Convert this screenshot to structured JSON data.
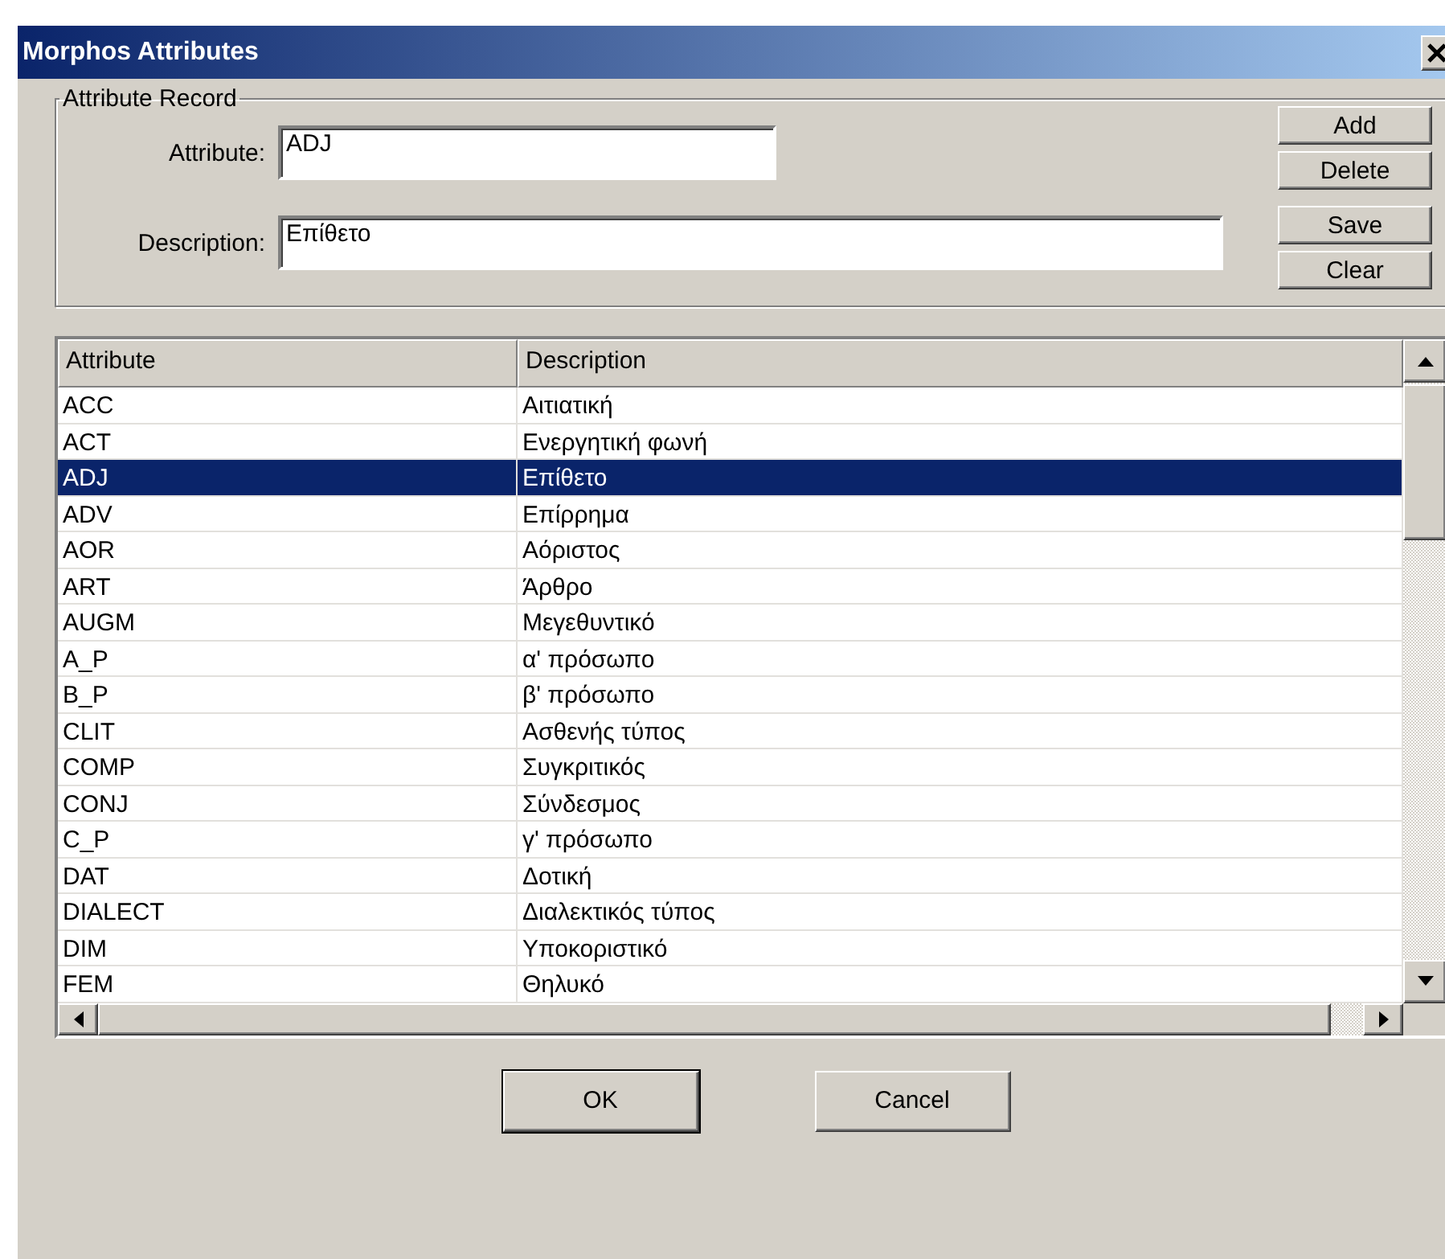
{
  "window": {
    "title": "Morphos Attributes"
  },
  "record": {
    "legend": "Attribute Record",
    "fields": [
      {
        "label": "Attribute:",
        "value": "ADJ",
        "kind": "short"
      },
      {
        "label": "Description:",
        "value": "Επίθετο",
        "kind": "long"
      }
    ],
    "buttons": [
      "Add",
      "Delete",
      "Save",
      "Clear"
    ]
  },
  "table": {
    "columns": [
      "Attribute",
      "Description"
    ],
    "rows": [
      {
        "cells": [
          "ACC",
          "Αιτιατική"
        ],
        "selected": false
      },
      {
        "cells": [
          "ACT",
          "Ενεργητική φωνή"
        ],
        "selected": false
      },
      {
        "cells": [
          "ADJ",
          "Επίθετο"
        ],
        "selected": true
      },
      {
        "cells": [
          "ADV",
          "Επίρρημα"
        ],
        "selected": false
      },
      {
        "cells": [
          "AOR",
          "Αόριστος"
        ],
        "selected": false
      },
      {
        "cells": [
          "ART",
          "Άρθρο"
        ],
        "selected": false
      },
      {
        "cells": [
          "AUGM",
          "Μεγεθυντικό"
        ],
        "selected": false
      },
      {
        "cells": [
          "A_P",
          "α' πρόσωπο"
        ],
        "selected": false
      },
      {
        "cells": [
          "B_P",
          "β' πρόσωπο"
        ],
        "selected": false
      },
      {
        "cells": [
          "CLIT",
          "Ασθενής τύπος"
        ],
        "selected": false
      },
      {
        "cells": [
          "COMP",
          "Συγκριτικός"
        ],
        "selected": false
      },
      {
        "cells": [
          "CONJ",
          "Σύνδεσμος"
        ],
        "selected": false
      },
      {
        "cells": [
          "C_P",
          "γ' πρόσωπο"
        ],
        "selected": false
      },
      {
        "cells": [
          "DAT",
          "Δοτική"
        ],
        "selected": false
      },
      {
        "cells": [
          "DIALECT",
          "Διαλεκτικός τύπος"
        ],
        "selected": false
      },
      {
        "cells": [
          "DIM",
          "Υποκοριστικό"
        ],
        "selected": false
      },
      {
        "cells": [
          "FEM",
          "Θηλυκό"
        ],
        "selected": false
      }
    ]
  },
  "footer": [
    {
      "label": "OK",
      "default": true
    },
    {
      "label": "Cancel",
      "default": false
    }
  ]
}
